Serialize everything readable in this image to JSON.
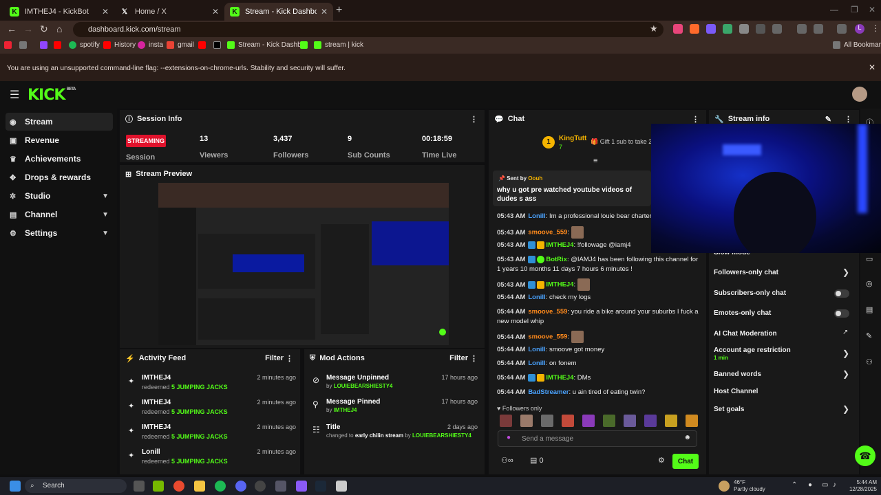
{
  "browser": {
    "tabs": [
      {
        "title": "IMTHEJ4 - KickBot",
        "icon": "kick-icon"
      },
      {
        "title": "Home / X",
        "icon": "x-icon"
      },
      {
        "title": "Stream - Kick Dashboard",
        "icon": "kick-icon",
        "active": true
      }
    ],
    "url": "dashboard.kick.com/stream",
    "bookmarks": [
      "spotify",
      "History",
      "insta",
      "gmail",
      "Stream - Kick Dashb...",
      "stream | kick"
    ],
    "all_bookmarks": "All Bookmarks",
    "warning": "You are using an unsupported command-line flag: --extensions-on-chrome-urls. Stability and security will suffer."
  },
  "app": {
    "logo": "KICK",
    "logo_tag": "BETA",
    "accent": "#53fc18"
  },
  "sidebar": {
    "items": [
      {
        "label": "Stream",
        "icon": "broadcast-icon"
      },
      {
        "label": "Revenue",
        "icon": "wallet-icon"
      },
      {
        "label": "Achievements",
        "icon": "trophy-icon"
      },
      {
        "label": "Drops & rewards",
        "icon": "gift-icon"
      },
      {
        "label": "Studio",
        "icon": "studio-icon"
      },
      {
        "label": "Channel",
        "icon": "channel-icon"
      },
      {
        "label": "Settings",
        "icon": "gear-icon"
      }
    ]
  },
  "session": {
    "title": "Session Info",
    "status": "STREAMING",
    "status_label": "Session",
    "stats": [
      {
        "value": "13",
        "label": "Viewers"
      },
      {
        "value": "3,437",
        "label": "Followers"
      },
      {
        "value": "9",
        "label": "Sub Counts"
      },
      {
        "value": "00:18:59",
        "label": "Time Live"
      }
    ]
  },
  "preview": {
    "title": "Stream Preview"
  },
  "activity": {
    "title": "Activity Feed",
    "filter": "Filter",
    "items": [
      {
        "name": "IMTHEJ4",
        "action": "redeemed",
        "reward": "5 JUMPING JACKS",
        "time": "2 minutes ago"
      },
      {
        "name": "IMTHEJ4",
        "action": "redeemed",
        "reward": "5 JUMPING JACKS",
        "time": "2 minutes ago"
      },
      {
        "name": "IMTHEJ4",
        "action": "redeemed",
        "reward": "5 JUMPING JACKS",
        "time": "2 minutes ago"
      },
      {
        "name": "Lonill",
        "action": "redeemed",
        "reward": "5 JUMPING JACKS",
        "time": "2 minutes ago"
      }
    ]
  },
  "mod": {
    "title": "Mod Actions",
    "filter": "Filter",
    "items": [
      {
        "title": "Message Unpinned",
        "by": "by",
        "user": "LOUIEBEARSHIESTY4",
        "time": "17 hours ago",
        "icon": "unpin-icon"
      },
      {
        "title": "Message Pinned",
        "by": "by",
        "user": "IMTHEJ4",
        "time": "17 hours ago",
        "icon": "pin-icon"
      },
      {
        "title": "Title",
        "by": "changed to",
        "value": "early chilin stream",
        "by2": "by",
        "user": "LOUIEBEARSHIESTY4",
        "time": "2 days ago",
        "icon": "title-icon"
      }
    ]
  },
  "chat": {
    "title": "Chat",
    "gift": {
      "user": "KingTutt",
      "count": "7",
      "rank": "1",
      "text": "Gift 1 sub to take 2n"
    },
    "pinned": {
      "sent_by_label": "Sent by",
      "sender": "Oouh",
      "text": "why u got pre watched youtube videos of dudes s ass"
    },
    "messages": [
      {
        "time": "05:43 AM",
        "user": "Lonill",
        "color": "#4aa3ff",
        "text": "Im a professional louie bear charter"
      },
      {
        "time": "05:43 AM",
        "user": "smoove_559",
        "color": "#ff8a1c",
        "text": "",
        "emote": true
      },
      {
        "time": "05:43 AM",
        "user": "IMTHEJ4",
        "color": "#53fc18",
        "text": "!followage @iamj4"
      },
      {
        "time": "05:43 AM",
        "user": "BotRix",
        "color": "#53fc18",
        "text": "@IAMJ4 has been following this channel for 1 years 10 months 11 days 7 hours 6 minutes !"
      },
      {
        "time": "05:43 AM",
        "user": "IMTHEJ4",
        "color": "#53fc18",
        "text": "",
        "emote": true
      },
      {
        "time": "05:44 AM",
        "user": "Lonill",
        "color": "#4aa3ff",
        "text": "check my logs"
      },
      {
        "time": "05:44 AM",
        "user": "smoove_559",
        "color": "#ff8a1c",
        "text": "you ride a bike around your suburbs I fuck a new model whip"
      },
      {
        "time": "05:44 AM",
        "user": "smoove_559",
        "color": "#ff8a1c",
        "text": "",
        "emote": true
      },
      {
        "time": "05:44 AM",
        "user": "Lonill",
        "color": "#4aa3ff",
        "text": "smoove got money"
      },
      {
        "time": "05:44 AM",
        "user": "Lonill",
        "color": "#4aa3ff",
        "text": "on fonem"
      },
      {
        "time": "05:44 AM",
        "user": "IMTHEJ4",
        "color": "#53fc18",
        "text": "DMs"
      },
      {
        "time": "05:44 AM",
        "user": "BadStreamer",
        "color": "#4aa3ff",
        "text": "u ain tired of eating twin?"
      }
    ],
    "followers_only": "Followers only",
    "placeholder": "Send a message",
    "points": "0",
    "send": "Chat"
  },
  "stream_info": {
    "title": "Stream info",
    "rows": [
      {
        "label": "Slow mode",
        "type": "arrow"
      },
      {
        "label": "Followers-only chat",
        "type": "arrow"
      },
      {
        "label": "Subscribers-only chat",
        "type": "toggle"
      },
      {
        "label": "Emotes-only chat",
        "type": "toggle"
      },
      {
        "label": "AI Chat Moderation",
        "type": "link"
      },
      {
        "label": "Account age restriction",
        "sub": "1 min",
        "type": "arrow"
      },
      {
        "label": "Banned words",
        "type": "arrow"
      },
      {
        "label": "Host Channel",
        "type": "none"
      },
      {
        "label": "Set goals",
        "type": "arrow"
      }
    ]
  },
  "taskbar": {
    "search": "Search",
    "weather_temp": "46°F",
    "weather_desc": "Partly cloudy",
    "time": "5:44 AM",
    "date": "12/28/2025"
  }
}
